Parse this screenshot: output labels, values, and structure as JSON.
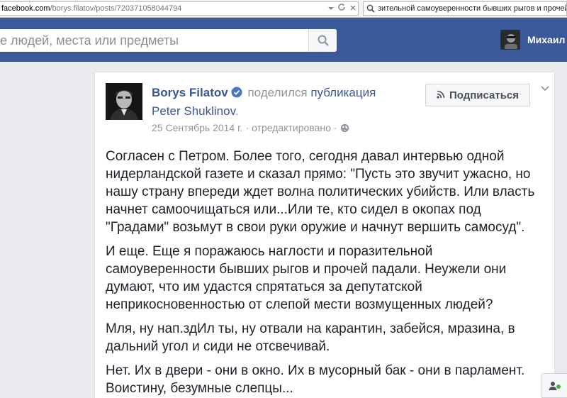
{
  "browser": {
    "url_host": "facebook.com",
    "url_path": "/borys.filatov/posts/720371058044794",
    "search_text": "зительной самоуверенности бывших рыгов и прочей п"
  },
  "topbar": {
    "search_placeholder": "е людей, места или предметы",
    "user_name": "Михаил"
  },
  "post": {
    "author": "Borys Filatov",
    "shared_text": "поделился",
    "shared_link": "публикация",
    "source_author": "Peter Shuklinov",
    "date": "25 Сентябрь 2014 г.",
    "edited": "отредактировано",
    "subscribe_label": "Подписаться",
    "paragraphs": [
      "Согласен с Петром. Более того, сегодня давал интервью одной нидерландской газете и сказал прямо: \"Пусть это звучит ужасно, но нашу страну впереди ждет волна политических убийств. Или власть начнет самоочищаться или...Или те, кто сидел в окопах под \"Градами\" возьмут в свои руки оружие и начнут вершить самосуд\".",
      "И еще. Еще я поражаюсь наглости и поразительной самоуверенности бывших рыгов и прочей падали. Неужели они думают, что им удастся спрятаться за депутатской неприкосновенностью от слепой мести возмущенных людей?",
      "Мля, ну нап.здИл ты, ну отвали на карантин, забейся, мразина, в дальний угол и сиди не отсвечивай.",
      "Нет. Их в двери - они в окно. Их в мусорный бак - они в парламент. Воистину, безумные слепцы..."
    ]
  },
  "colors": {
    "fb_blue": "#3b5998",
    "link": "#365899",
    "meta_gray": "#90949c",
    "text": "#1d2129"
  },
  "icons": [
    "search-icon",
    "reload-icon",
    "dropdown-arrow-icon",
    "verified-icon",
    "rss-icon",
    "chevron-down-icon",
    "globe-icon",
    "chat-friends-icon"
  ]
}
